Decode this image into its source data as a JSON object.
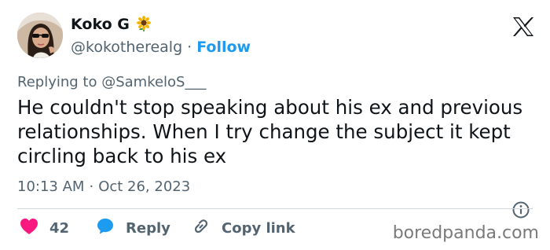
{
  "author": {
    "display_name": "Koko G",
    "name_emoji": "sunflower",
    "handle": "@kokotherealg",
    "separator": "·",
    "follow_label": "Follow"
  },
  "replying_to": "Replying to @SamkeloS___",
  "tweet_text": "He couldn't stop speaking about his ex and previous relationships. When I try change the subject it kept circling back to his ex",
  "timestamp": {
    "time": "10:13 AM",
    "separator": "·",
    "date": "Oct 26, 2023"
  },
  "actions": {
    "likes_count": "42",
    "reply_label": "Reply",
    "copy_link_label": "Copy link"
  },
  "watermark": "boredpanda.com",
  "icons": {
    "brand": "x-logo-icon",
    "info": "info-icon",
    "like": "heart-icon",
    "reply": "speech-bubble-icon",
    "copy": "link-icon"
  },
  "colors": {
    "text": "#0f1419",
    "secondary": "#536471",
    "link": "#1d9bf0",
    "like": "#f91880",
    "divider": "#cfd9de"
  }
}
